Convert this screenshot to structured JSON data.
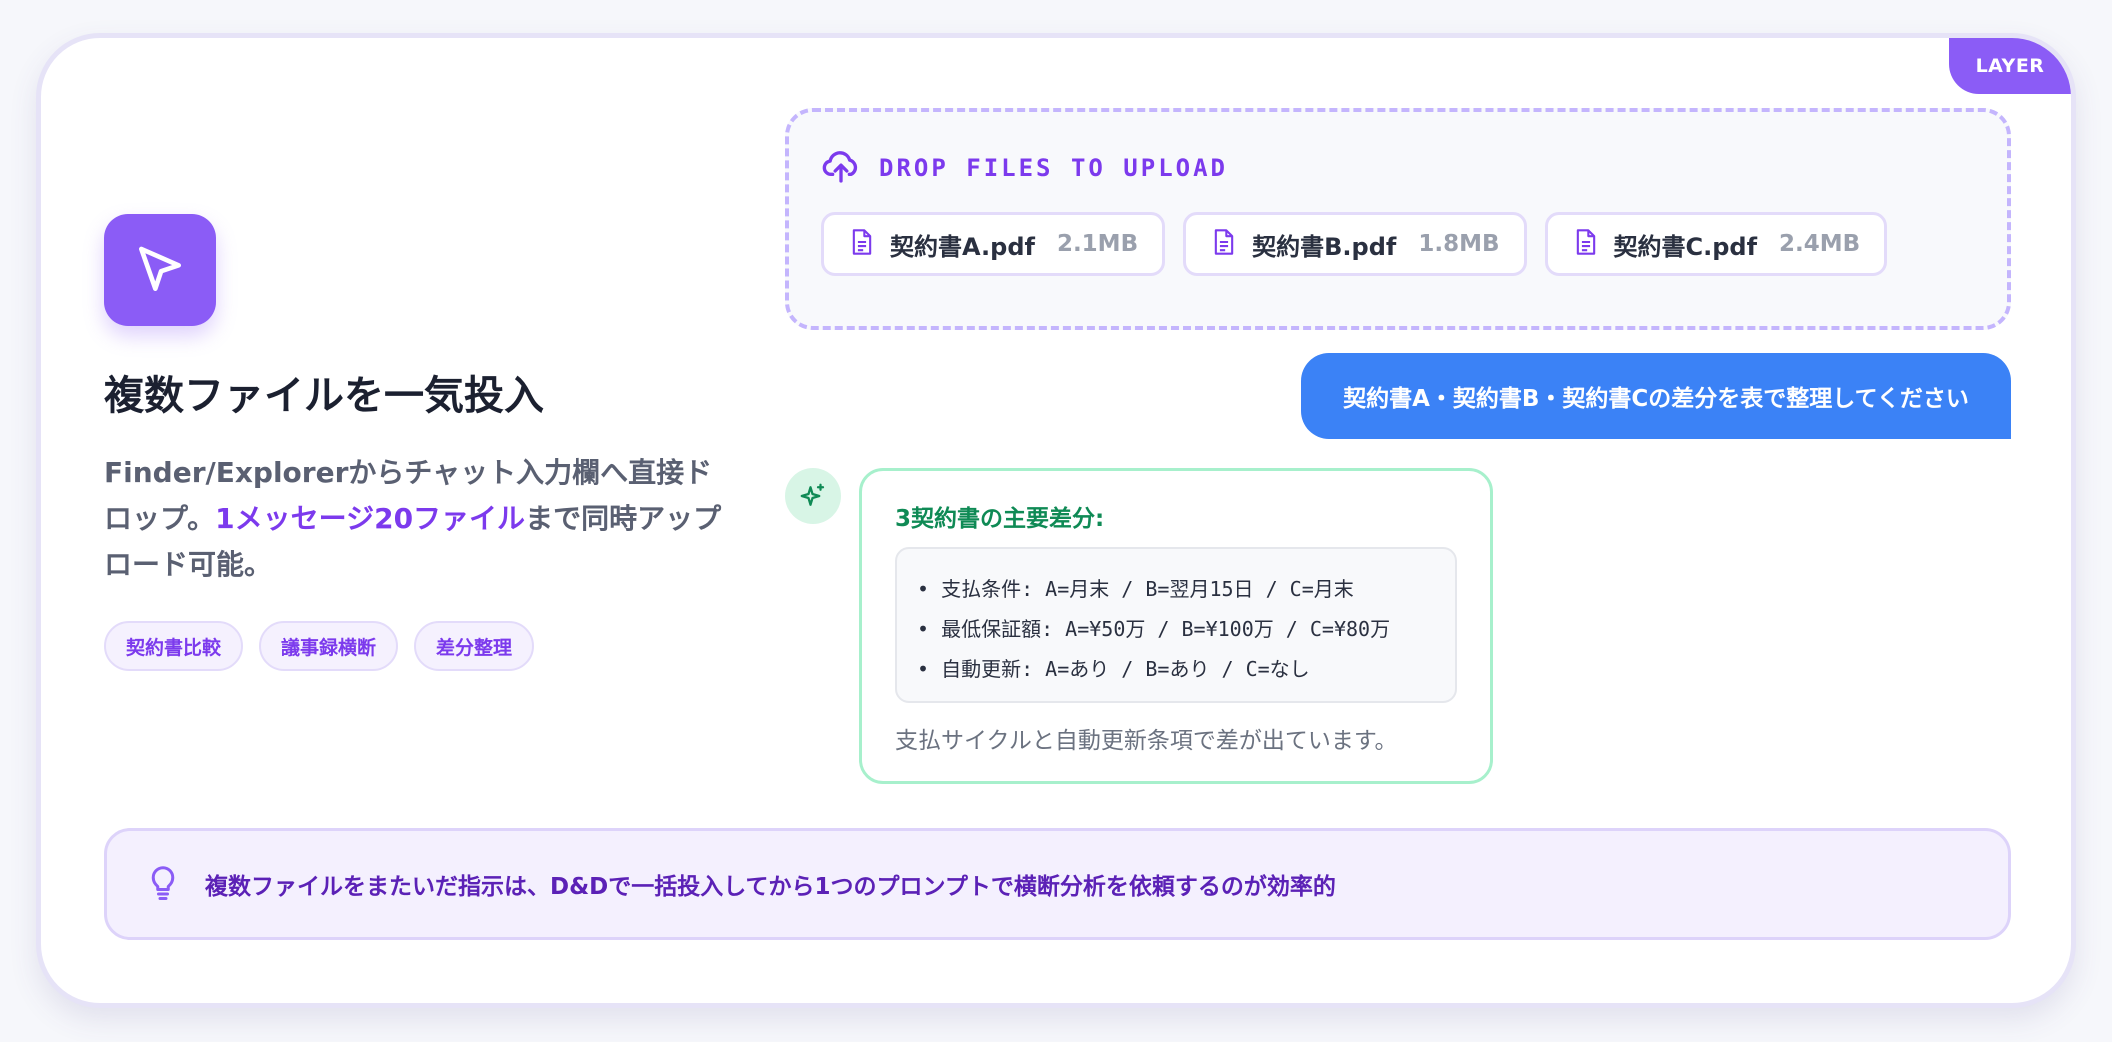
{
  "badge": "LAYER",
  "feature": {
    "icon": "cursor-arrow-icon",
    "title": "複数ファイルを一気投入",
    "desc_pre": "Finder/Explorerからチャット入力欄へ直接ドロップ。",
    "desc_highlight": "1メッセージ20ファイル",
    "desc_post": "まで同時アップロード可能。",
    "tags": [
      "契約書比較",
      "議事録横断",
      "差分整理"
    ]
  },
  "dropzone": {
    "icon": "cloud-upload-icon",
    "title": "DROP FILES TO UPLOAD",
    "files": [
      {
        "name": "契約書A.pdf",
        "size": "2.1MB",
        "icon": "document-icon"
      },
      {
        "name": "契約書B.pdf",
        "size": "1.8MB",
        "icon": "document-icon"
      },
      {
        "name": "契約書C.pdf",
        "size": "2.4MB",
        "icon": "document-icon"
      }
    ]
  },
  "chat": {
    "user_message": "契約書A・契約書B・契約書Cの差分を表で整理してください",
    "assistant": {
      "icon": "sparkle-icon",
      "title": "3契約書の主要差分:",
      "lines": [
        "• 支払条件: A=月末 / B=翌月15日 / C=月末",
        "• 最低保証額: A=¥50万 / B=¥100万 / C=¥80万",
        "• 自動更新: A=あり / B=あり / C=なし"
      ],
      "footer": "支払サイクルと自動更新条項で差が出ています。"
    }
  },
  "tip": {
    "icon": "lightbulb-icon",
    "text": "複数ファイルをまたいだ指示は、D&Dで一括投入してから1つのプロンプトで横断分析を依頼するのが効率的"
  },
  "colors": {
    "accent": "#8b5cf6",
    "user_bubble": "#3b82f6",
    "assistant_title": "#0f8a55",
    "tip_text": "#5b21b6"
  }
}
